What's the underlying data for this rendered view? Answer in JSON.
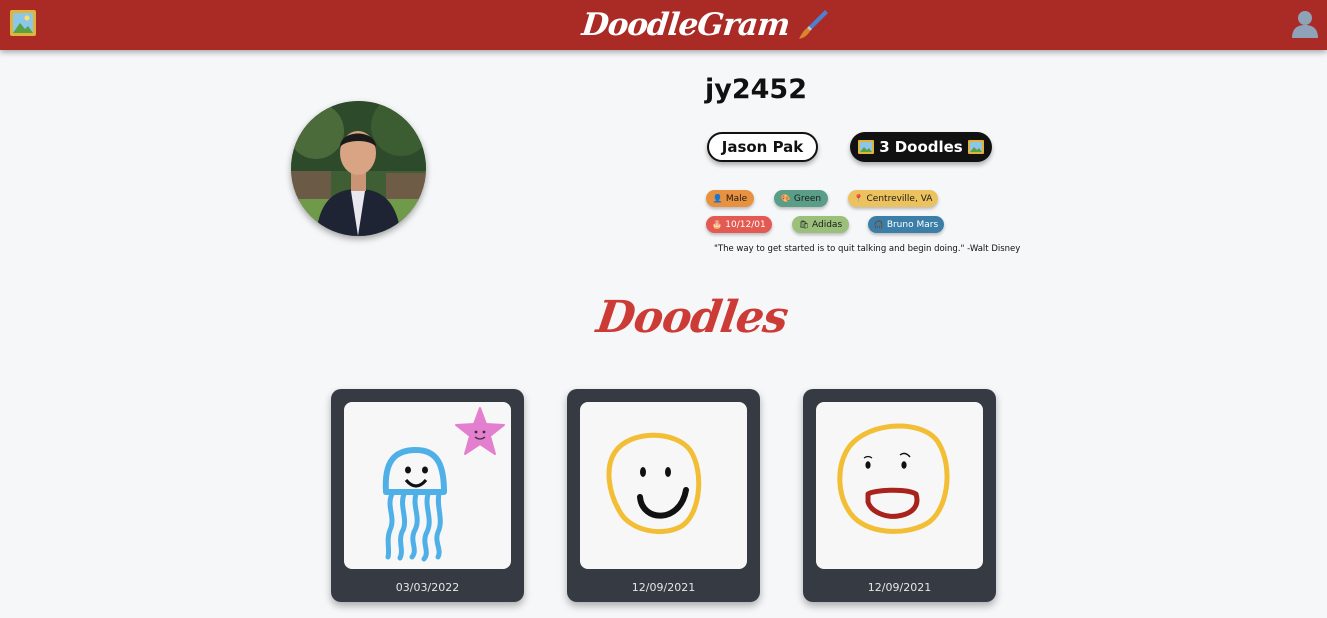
{
  "header": {
    "brand_name": "DoodleGram",
    "home_icon": "framed-picture-icon",
    "brand_icon": "paintbrush-icon",
    "account_icon": "user-silhouette-icon",
    "background_color": "#aa2a25"
  },
  "profile": {
    "username": "jy2452",
    "display_name": "Jason Pak",
    "doodle_count": "3",
    "doodle_count_label": "Doodles",
    "tags": {
      "gender": "Male",
      "favorite_color": "Green",
      "location": "Centreville, VA",
      "birthday": "10/12/01",
      "brand": "Adidas",
      "music": "Bruno Mars"
    },
    "quote": "\"The way to get started is to quit talking and begin doing.\" -Walt Disney"
  },
  "doodles_section": {
    "title": "Doodles",
    "title_color": "#cc3b35",
    "items": [
      {
        "date": "03/03/2022",
        "subject": "jellyfish-and-starfish"
      },
      {
        "date": "12/09/2021",
        "subject": "smiley-face"
      },
      {
        "date": "12/09/2021",
        "subject": "laughing-face"
      }
    ]
  }
}
